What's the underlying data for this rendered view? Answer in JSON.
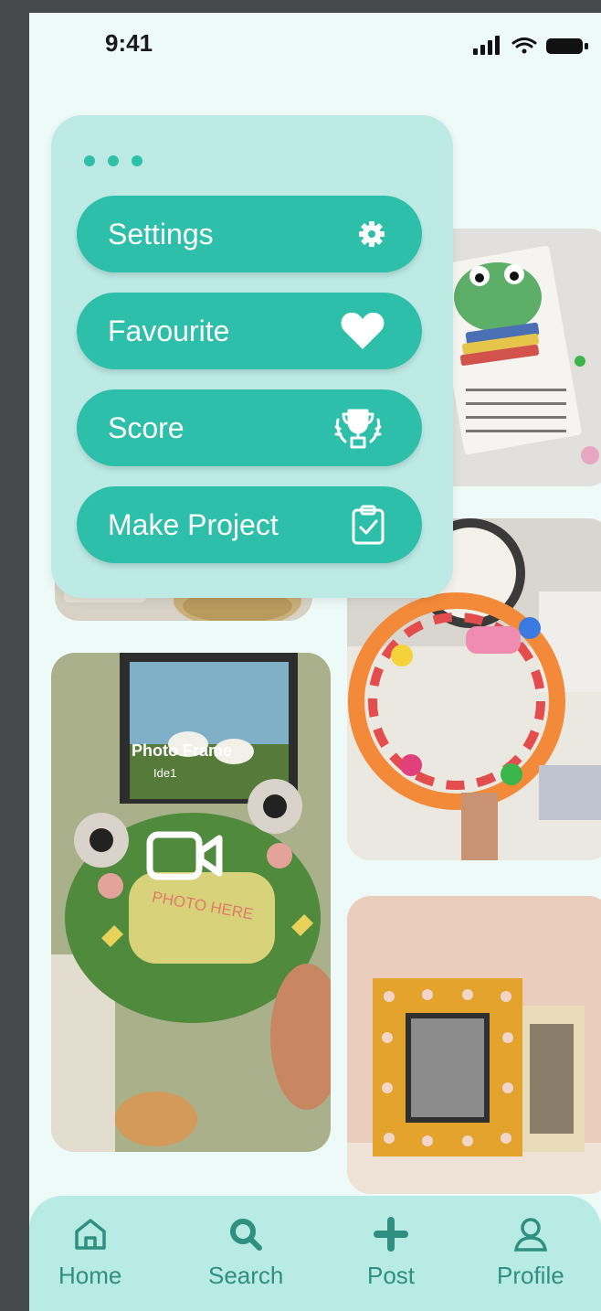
{
  "status_bar": {
    "time": "9:41"
  },
  "menu": {
    "items": [
      {
        "label": "Settings",
        "icon": "gear-icon"
      },
      {
        "label": "Favourite",
        "icon": "heart-icon"
      },
      {
        "label": "Score",
        "icon": "trophy-icon"
      },
      {
        "label": "Make Project",
        "icon": "clipboard-check-icon"
      }
    ]
  },
  "feed": {
    "photo_frame_overlay": {
      "title": "Photo Frame",
      "subtitle": "Ide1",
      "frame_text": "PHOTO HERE"
    }
  },
  "nav": {
    "items": [
      {
        "label": "Home",
        "icon": "home-icon"
      },
      {
        "label": "Search",
        "icon": "search-icon"
      },
      {
        "label": "Post",
        "icon": "plus-icon"
      },
      {
        "label": "Profile",
        "icon": "user-icon"
      }
    ]
  },
  "colors": {
    "accent": "#2dbfa9",
    "menu_background": "#bdeae5",
    "nav_background": "#b8ebe4",
    "nav_text": "#2f8f80",
    "screen_background": "#eefaf8"
  }
}
